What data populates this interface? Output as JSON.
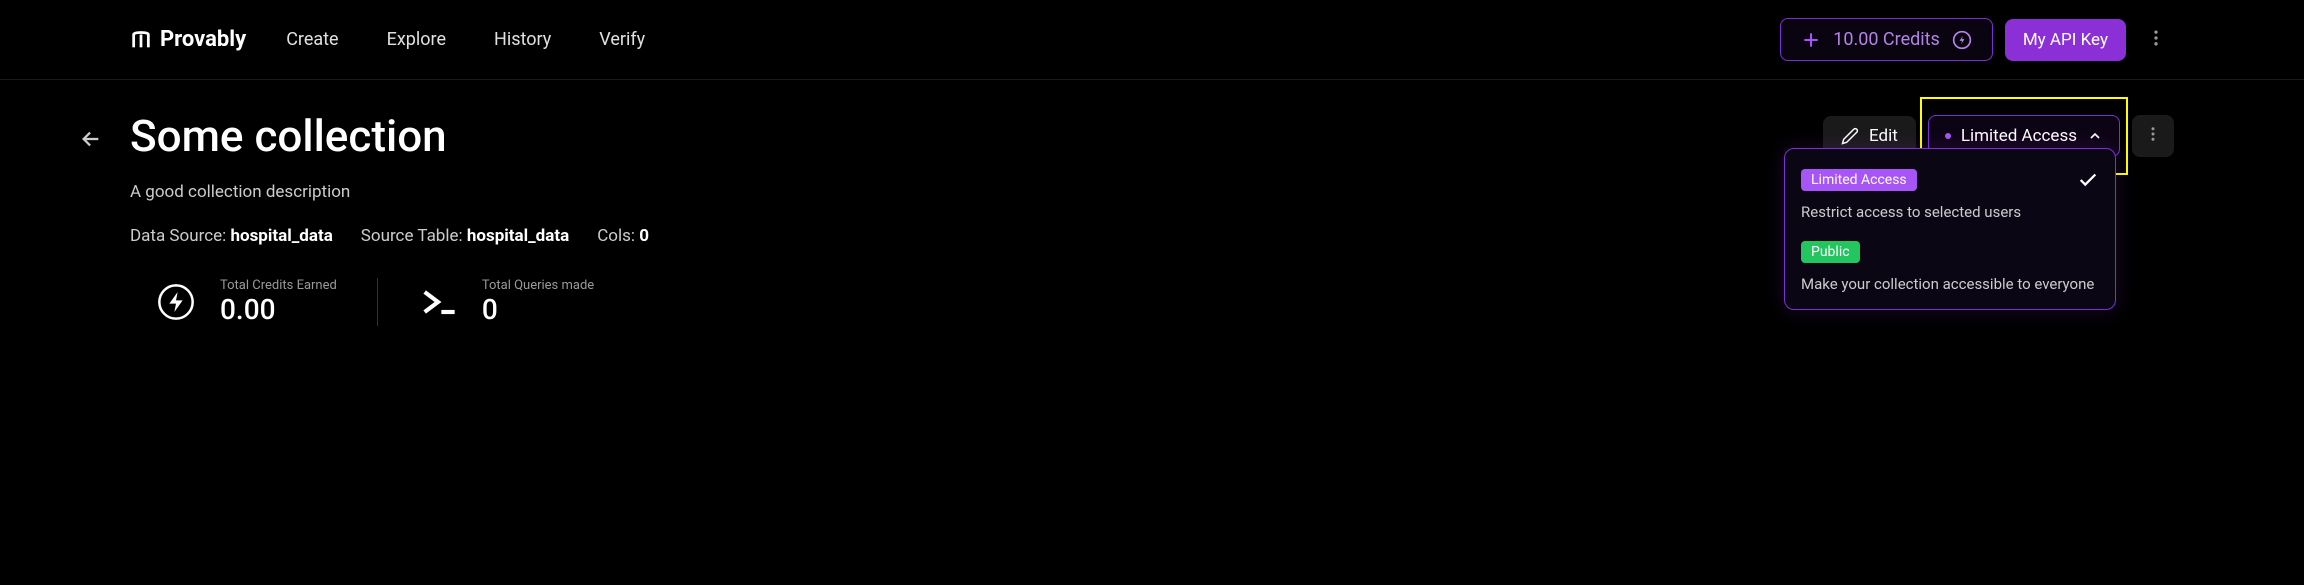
{
  "header": {
    "brand": "Provably",
    "nav": {
      "create": "Create",
      "explore": "Explore",
      "history": "History",
      "verify": "Verify"
    },
    "credits": "10.00 Credits",
    "api_key": "My API Key"
  },
  "page": {
    "title": "Some collection",
    "description": "A good collection description",
    "data_source_label": "Data Source: ",
    "data_source_value": "hospital_data",
    "source_table_label": "Source Table: ",
    "source_table_value": "hospital_data",
    "cols_label": "Cols: ",
    "cols_value": "0"
  },
  "actions": {
    "edit": "Edit",
    "access": "Limited Access"
  },
  "stats": {
    "credits_label": "Total Credits Earned",
    "credits_value": "0.00",
    "queries_label": "Total Queries made",
    "queries_value": "0"
  },
  "dropdown": {
    "limited_badge": "Limited Access",
    "limited_desc": "Restrict access to selected users",
    "public_badge": "Public",
    "public_desc": "Make your collection accessible to everyone"
  }
}
